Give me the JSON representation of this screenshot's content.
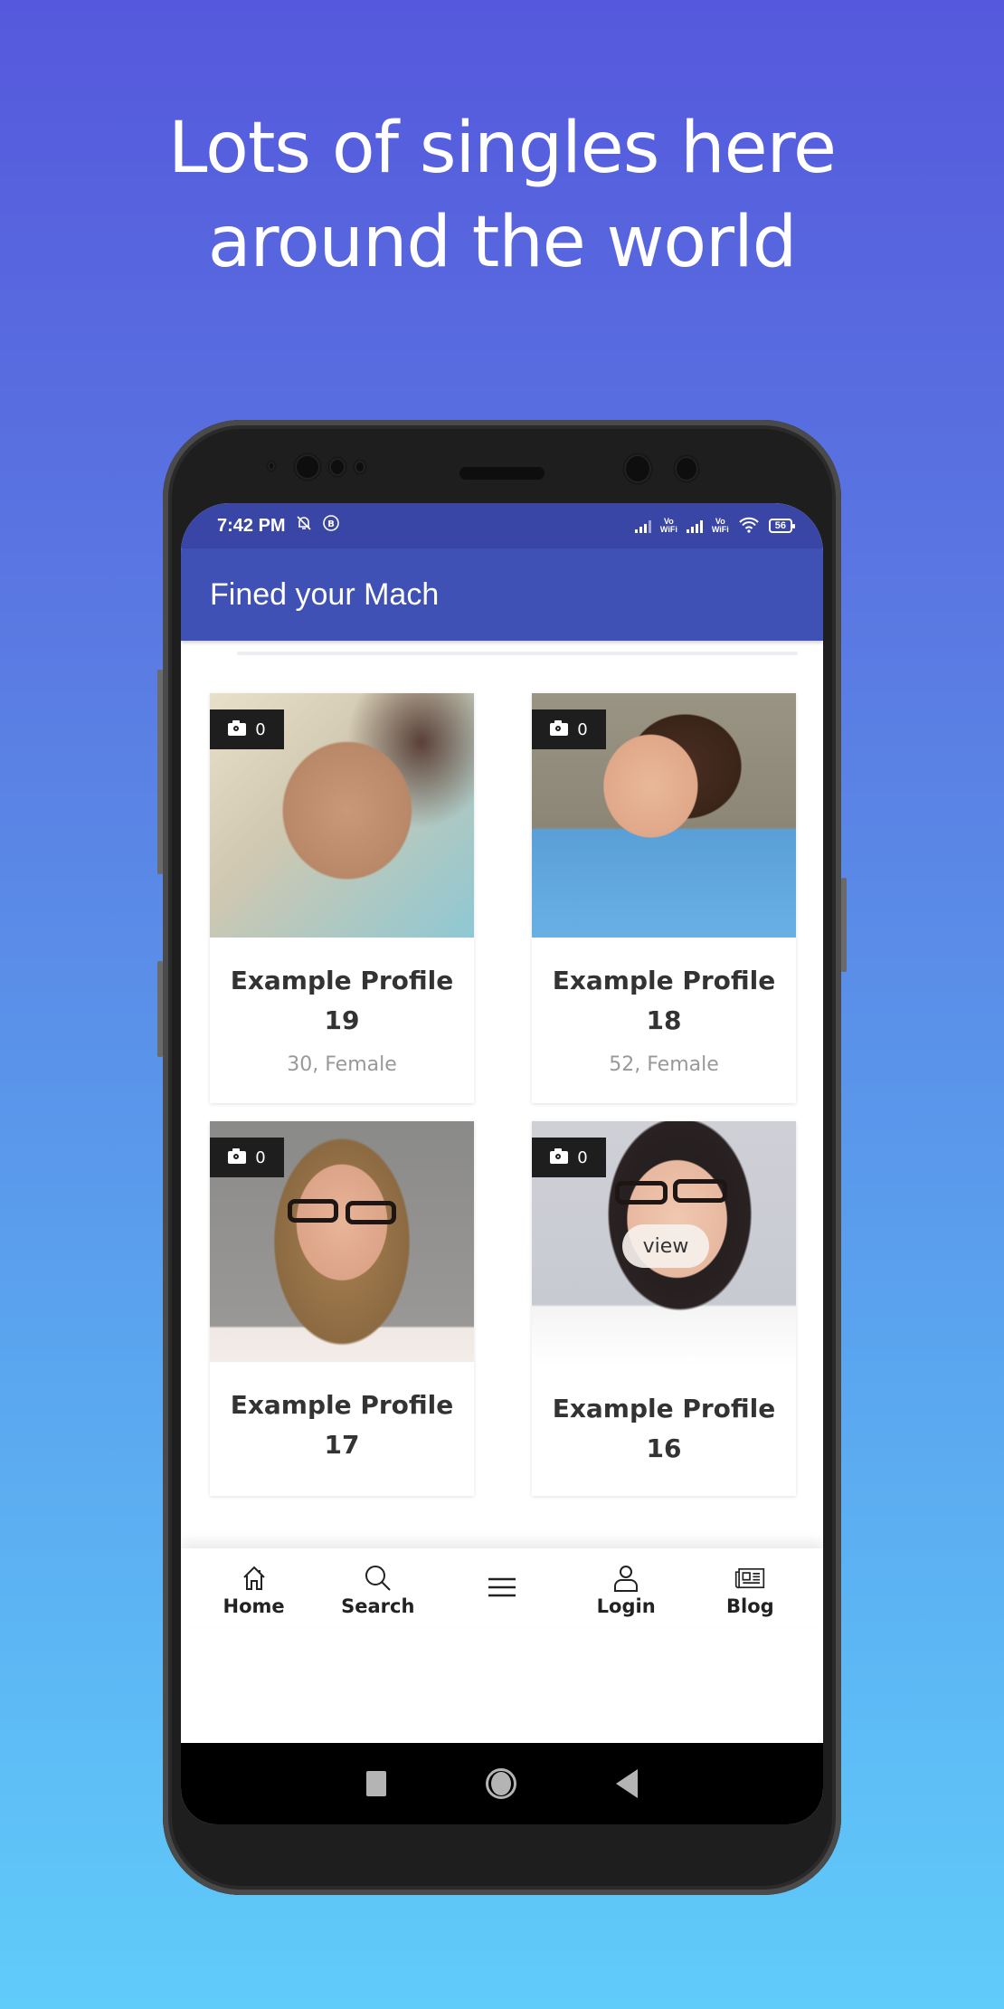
{
  "headline": {
    "line1": "Lots of singles here",
    "line2": "around the world"
  },
  "status_bar": {
    "time": "7:42 PM",
    "battery": "56",
    "vowifi_label": "Vo WiFi"
  },
  "app_bar": {
    "title": "Fined your Mach"
  },
  "profiles": [
    {
      "name": "Example Profile 19",
      "meta": "30, Female",
      "photo_count": "0"
    },
    {
      "name": "Example Profile 18",
      "meta": "52, Female",
      "photo_count": "0"
    },
    {
      "name": "Example Profile 17",
      "meta": "",
      "photo_count": "0"
    },
    {
      "name": "Example Profile 16",
      "meta": "",
      "photo_count": "0",
      "hover_label": "view"
    }
  ],
  "bottom_nav": {
    "items": [
      {
        "label": "Home",
        "icon": "home-icon"
      },
      {
        "label": "Search",
        "icon": "search-icon"
      },
      {
        "label": "",
        "icon": "menu-icon"
      },
      {
        "label": "Login",
        "icon": "user-icon"
      },
      {
        "label": "Blog",
        "icon": "newspaper-icon"
      }
    ]
  },
  "colors": {
    "primary": "#3f51b5",
    "status_bar": "#3a46a6",
    "background_top": "#5558dc",
    "background_bottom": "#60ccfa"
  }
}
